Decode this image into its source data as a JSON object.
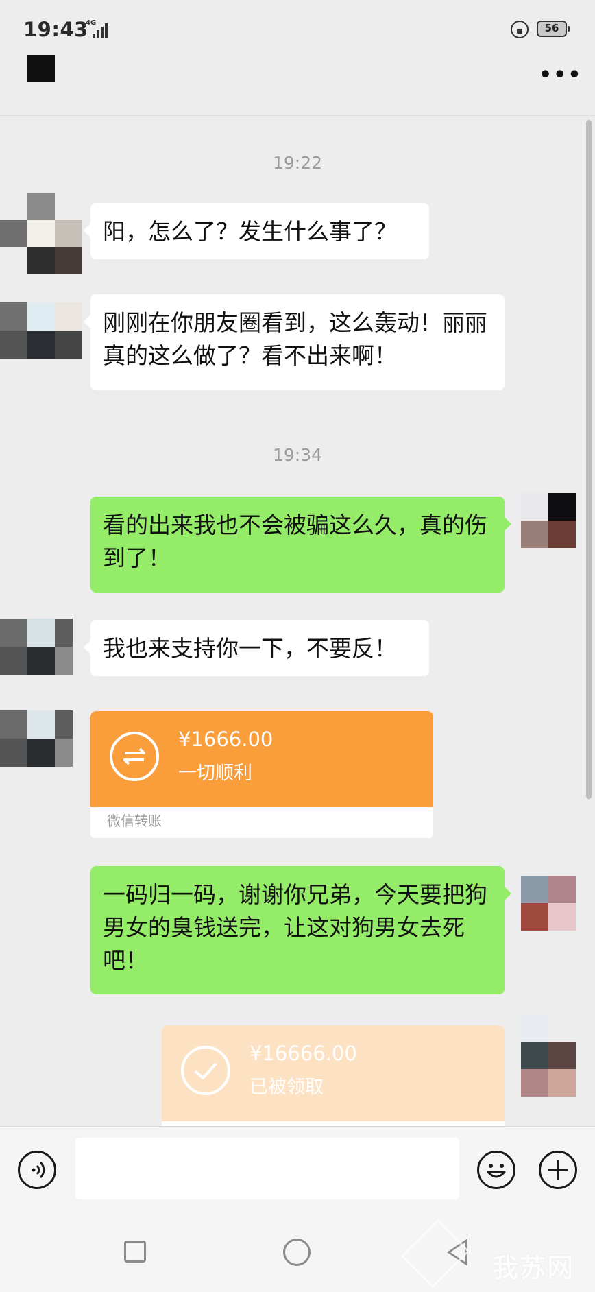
{
  "status": {
    "time": "19:43",
    "network": "4G",
    "battery": "56"
  },
  "header": {
    "more_label": "•••"
  },
  "messages": {
    "ts1": "19:22",
    "m1": "阳，怎么了？发生什么事了？",
    "m2": "刚刚在你朋友圈看到，这么轰动！丽丽真的这么做了？看不出来啊！",
    "ts2": "19:34",
    "m3": "看的出来我也不会被骗这么久，真的伤到了！",
    "m4": "我也来支持你一下，不要反！",
    "t1": {
      "amount": "¥1666.00",
      "note": "一切顺利",
      "label": "微信转账"
    },
    "m5": "一码归一码，谢谢你兄弟，今天要把狗男女的臭钱送完，让这对狗男女去死吧！",
    "t2": {
      "amount": "¥16666.00",
      "note": "已被领取"
    }
  },
  "colors": {
    "incoming_bubble": "#ffffff",
    "outgoing_bubble": "#95ec69",
    "transfer_pending": "#fa9d3b",
    "transfer_received": "#fde1c3",
    "background": "#ededed"
  },
  "inputbar": {
    "voice_icon": "voice-icon",
    "emoji_icon": "emoji-icon",
    "plus_icon": "plus-icon"
  },
  "watermark": "我苏网"
}
